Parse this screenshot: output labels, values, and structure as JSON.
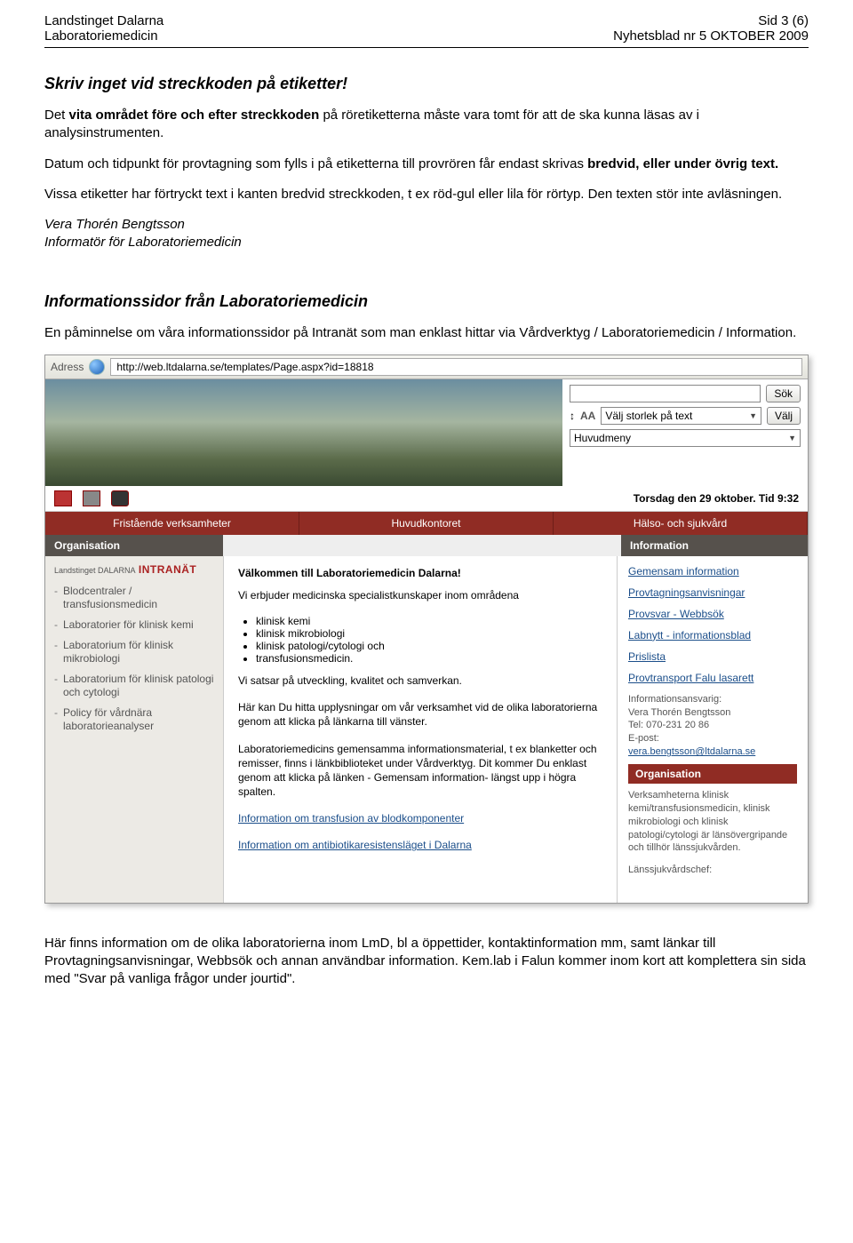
{
  "header": {
    "left1": "Landstinget Dalarna",
    "left2": "Laboratoriemedicin",
    "right1": "Sid 3 (6)",
    "right2": "Nyhetsblad nr 5 OKTOBER 2009"
  },
  "section1": {
    "title": "Skriv inget vid streckkoden på etiketter!",
    "p1a": "Det ",
    "p1b": "vita området före och efter streckkoden",
    "p1c": " på röretiketterna måste vara tomt för att de ska kunna läsas av i analysinstrumenten.",
    "p2a": "Datum och tidpunkt för provtagning som fylls i på etiketterna till provrören får endast skrivas ",
    "p2b": "bredvid, eller under övrig text.",
    "p3": "Vissa etiketter har förtryckt text i kanten bredvid streckkoden, t ex röd-gul eller lila för rörtyp. Den texten stör inte avläsningen.",
    "sig1": "Vera Thorén Bengtsson",
    "sig2": "Informatör för Laboratoriemedicin"
  },
  "section2": {
    "title": "Informationssidor från Laboratoriemedicin",
    "p1": "En påminnelse om våra informationssidor på Intranät som man enklast hittar via Vårdverktyg / Laboratoriemedicin / Information."
  },
  "shot": {
    "addr_label": "Adress",
    "url": "http://web.ltdalarna.se/templates/Page.aspx?id=18818",
    "search_btn": "Sök",
    "size_sel": "Välj storlek på text",
    "size_btn": "Välj",
    "menu_sel": "Huvudmeny",
    "aa": "AA",
    "date": "Torsdag den 29 oktober. Tid 9:32",
    "tabs": [
      "Fristående verksamheter",
      "Huvudkontoret",
      "Hälso- och sjukvård"
    ],
    "sub_left": "Organisation",
    "sub_right": "Information",
    "left_logo": "INTRANÄT",
    "left_logo_pre": "Landstinget DALARNA",
    "left_items": [
      "Blodcentraler / transfusionsmedicin",
      "Laboratorier för klinisk kemi",
      "Laboratorium för klinisk mikrobiologi",
      "Laboratorium för klinisk patologi och cytologi",
      "Policy för vårdnära laboratorieanalyser"
    ],
    "mid": {
      "h": "Välkommen till Laboratoriemedicin Dalarna!",
      "p1": "Vi erbjuder medicinska specialistkunskaper inom områdena",
      "bullets": [
        "klinisk kemi",
        "klinisk mikrobiologi",
        "klinisk patologi/cytologi och",
        "transfusionsmedicin."
      ],
      "p2": "Vi satsar på utveckling, kvalitet och samverkan.",
      "p3": "Här kan Du hitta upplysningar om vår verksamhet vid de olika laboratorierna genom att klicka på länkarna till vänster.",
      "p4": "Laboratoriemedicins gemensamma informationsmaterial, t ex blanketter och remisser, finns i länkbiblioteket under Vårdverktyg. Dit kommer Du enklast genom att klicka på länken - Gemensam information- längst upp i högra spalten.",
      "link1": "Information om transfusion av blodkomponenter",
      "link2": "Information om antibiotikaresistensläget i Dalarna"
    },
    "right": {
      "links": [
        "Gemensam information",
        "Provtagningsanvisningar",
        "Provsvar - Webbsök",
        "Labnytt - informationsblad",
        "Prislista",
        "Provtransport Falu lasarett"
      ],
      "info_label": "Informationsansvarig:",
      "info_name": "Vera Thorén Bengtsson",
      "info_tel": "Tel: 070-231 20 86",
      "info_epost": "E-post:",
      "info_mail": "vera.bengtsson@ltdalarna.se",
      "org_h": "Organisation",
      "org_p": "Verksamheterna klinisk kemi/transfusionsmedicin, klinisk mikrobiologi och klinisk patologi/cytologi är länsövergripande och tillhör länssjukvården.",
      "chef": "Länssjukvårdschef:"
    }
  },
  "footer": {
    "p": "Här finns information om de olika laboratorierna inom LmD, bl a öppettider, kontaktinformation mm, samt länkar till Provtagningsanvisningar, Webbsök och annan användbar information. Kem.lab i Falun kommer inom kort att komplettera sin sida med \"Svar på vanliga frågor under jourtid\"."
  }
}
